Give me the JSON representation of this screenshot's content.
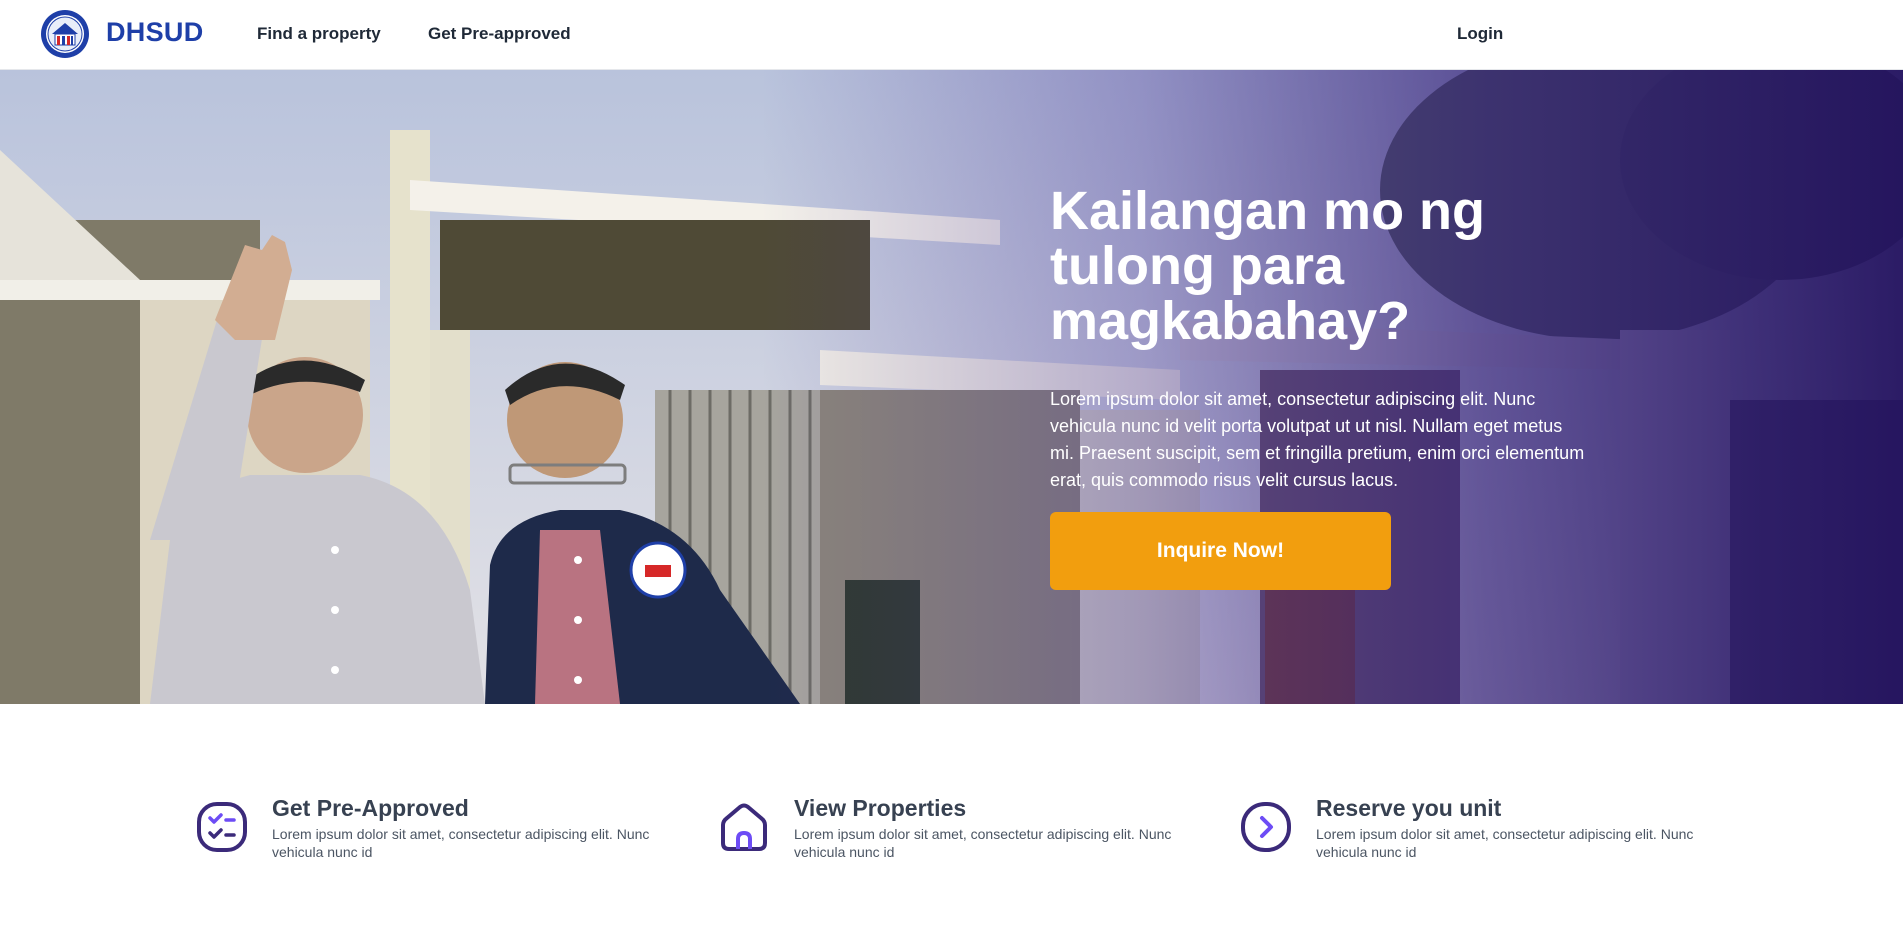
{
  "nav": {
    "brand": "DHSUD",
    "links": [
      {
        "label": "Find a property"
      },
      {
        "label": "Get Pre-approved"
      }
    ],
    "login": "Login"
  },
  "hero": {
    "title": "Kailangan mo ng tulong para magkabahay?",
    "text": "Lorem ipsum dolor sit amet, consectetur adipiscing elit. Nunc vehicula nunc id velit porta volutpat ut ut nisl. Nullam eget metus mi. Praesent suscipit, sem et fringilla pretium, enim orci elementum erat, quis commodo risus velit cursus lacus.",
    "cta": "Inquire Now!"
  },
  "features": [
    {
      "icon": "checklist-icon",
      "title": "Get Pre-Approved",
      "desc": "Lorem ipsum dolor sit amet, consectetur adipiscing elit. Nunc vehicula nunc id"
    },
    {
      "icon": "house-icon",
      "title": "View Properties",
      "desc": "Lorem ipsum dolor sit amet, consectetur adipiscing elit. Nunc vehicula nunc id"
    },
    {
      "icon": "chevron-right-circle-icon",
      "title": "Reserve you unit",
      "desc": "Lorem ipsum dolor sit amet, consectetur adipiscing elit. Nunc vehicula nunc id"
    }
  ],
  "colors": {
    "brand": "#1e3fa8",
    "accent": "#f29e0e",
    "icon": "#3b2a7a",
    "icon_highlight": "#6d4cf5"
  }
}
